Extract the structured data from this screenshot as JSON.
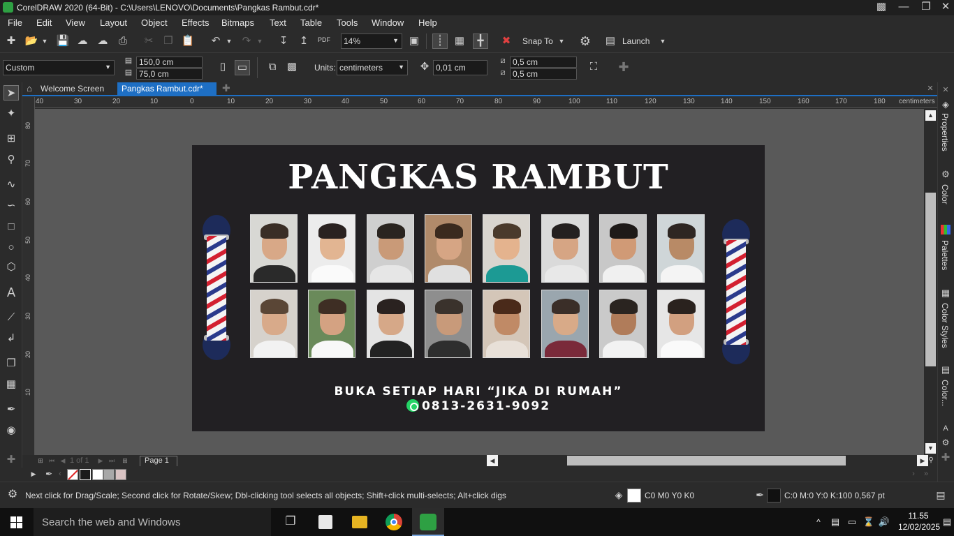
{
  "app": {
    "title": "CorelDRAW 2020 (64-Bit) - C:\\Users\\LENOVO\\Documents\\Pangkas Rambut.cdr*"
  },
  "menu": [
    "File",
    "Edit",
    "View",
    "Layout",
    "Object",
    "Effects",
    "Bitmaps",
    "Text",
    "Table",
    "Tools",
    "Window",
    "Help"
  ],
  "toolbar": {
    "zoom": "14%",
    "snap_to": "Snap To",
    "launch": "Launch",
    "pdf": "PDF"
  },
  "propbar": {
    "preset": "Custom",
    "width": "150,0 cm",
    "height": "75,0 cm",
    "units_label": "Units:",
    "units": "centimeters",
    "nudge": "0,01 cm",
    "dup_x": "0,5 cm",
    "dup_y": "0,5 cm"
  },
  "tabs": {
    "welcome": "Welcome Screen",
    "doc": "Pangkas Rambut.cdr*"
  },
  "ruler": {
    "h_ticks": [
      "40",
      "30",
      "20",
      "10",
      "0",
      "10",
      "20",
      "30",
      "40",
      "50",
      "60",
      "70",
      "80",
      "90",
      "100",
      "110",
      "120",
      "130",
      "140",
      "150",
      "160",
      "170",
      "180"
    ],
    "units": "centimeters",
    "v_ticks": [
      "80",
      "70",
      "60",
      "50",
      "40",
      "30",
      "20",
      "10"
    ]
  },
  "design": {
    "title": "PANGKAS RAMBUT",
    "open_text": "BUKA SETIAP HARI “JIKA DI RUMAH”",
    "phone": "0813-2631-9092"
  },
  "pagebar": {
    "page_count": "1 of 1",
    "page_label": "Page 1"
  },
  "docker": {
    "properties": "Properties",
    "color": "Color",
    "palettes": "Palettes",
    "color_styles": "Color Styles",
    "color2": "Color..."
  },
  "status": {
    "hint": "Next click for Drag/Scale; Second click for Rotate/Skew; Dbl-clicking tool selects all objects; Shift+click multi-selects; Alt+click digs",
    "fill": "C0 M0 Y0 K0",
    "outline": "C:0 M:0 Y:0 K:100  0,567 pt"
  },
  "taskbar": {
    "search": "Search the web and Windows",
    "time": "11.55",
    "date": "12/02/2025"
  },
  "colors": {
    "accent": "#1e6fc4",
    "canvas": "#595959",
    "design_bg": "#222023"
  }
}
